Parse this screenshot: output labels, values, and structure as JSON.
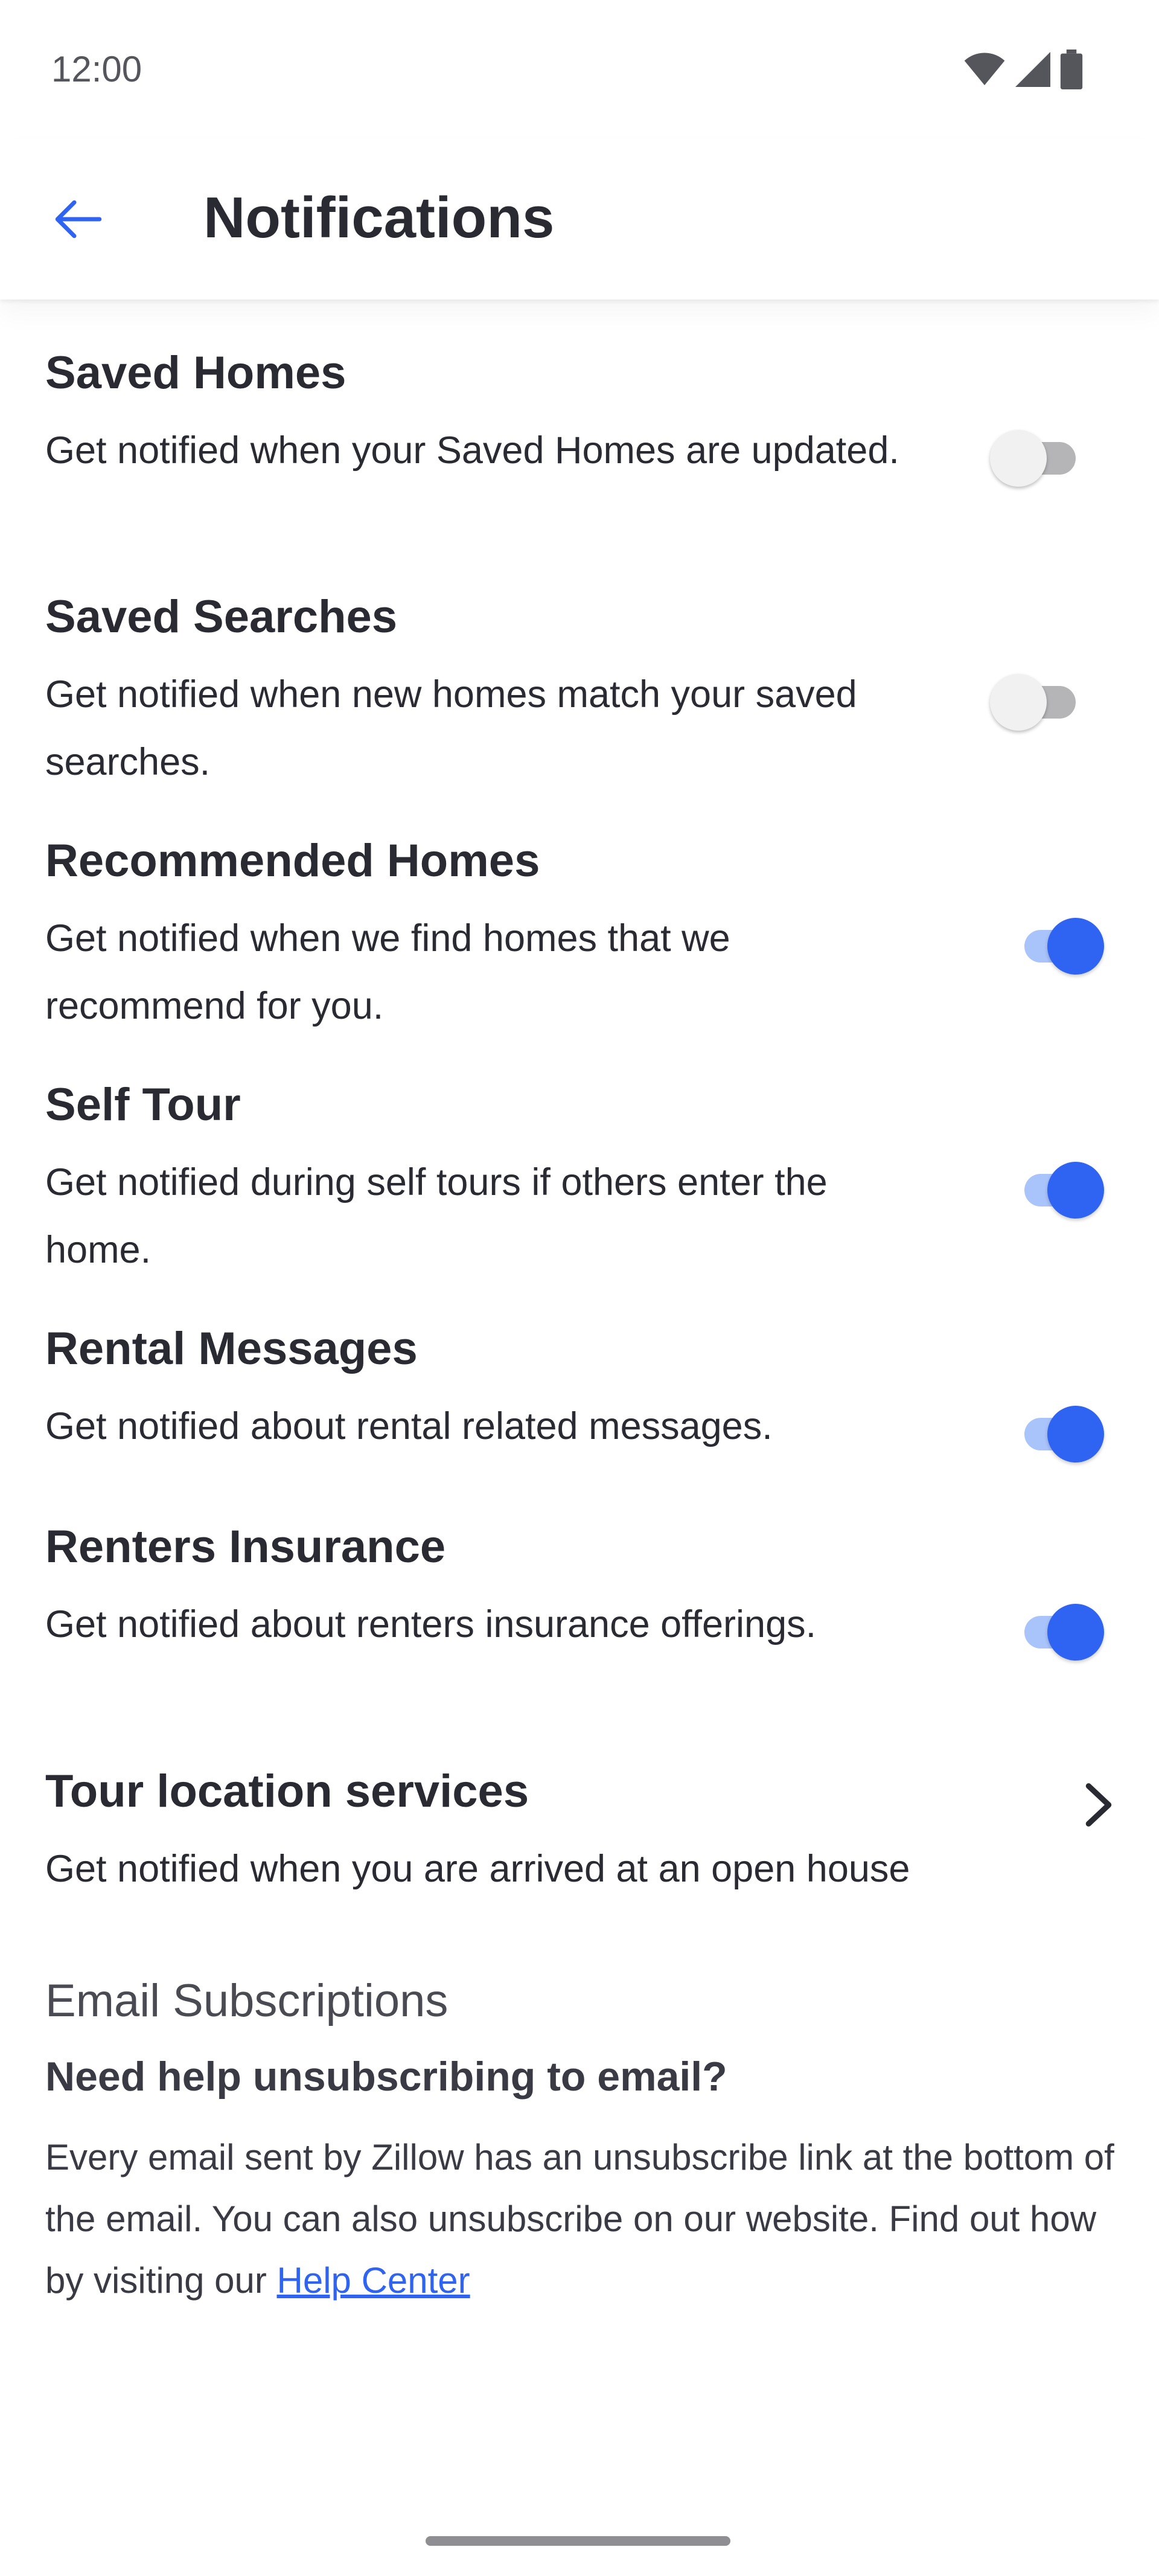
{
  "status_bar": {
    "time": "12:00"
  },
  "header": {
    "title": "Notifications"
  },
  "settings": [
    {
      "label": "Saved Homes",
      "description": "Get notified when your Saved Homes are updated.",
      "enabled": false
    },
    {
      "label": "Saved Searches",
      "description": "Get notified when new homes match your saved searches.",
      "enabled": false
    },
    {
      "label": "Recommended Homes",
      "description": "Get notified when we find homes that we recommend for you.",
      "enabled": true
    },
    {
      "label": "Self Tour",
      "description": "Get notified during self tours if others enter the home.",
      "enabled": true
    },
    {
      "label": "Rental Messages",
      "description": "Get notified about rental related messages.",
      "enabled": true
    },
    {
      "label": "Renters Insurance",
      "description": "Get notified about renters insurance offerings.",
      "enabled": true
    }
  ],
  "tour_location": {
    "label": "Tour location services",
    "description": "Get notified when you are arrived at an open house"
  },
  "email": {
    "heading": "Email Subscriptions",
    "subheading": "Need help unsubscribing to email?",
    "body": "Every email sent by Zillow has an unsubscribe link at the bottom of the email. You can also unsubscribe on our website. Find out how by visiting our ",
    "link_text": "Help Center"
  },
  "colors": {
    "accent": "#2f64f2",
    "accent_track": "#a9c3fb",
    "text": "#2a2a33"
  },
  "icons": {
    "back": "arrow-left-icon",
    "chevron": "chevron-right-icon",
    "wifi": "wifi-icon",
    "signal": "signal-icon",
    "battery": "battery-icon"
  }
}
